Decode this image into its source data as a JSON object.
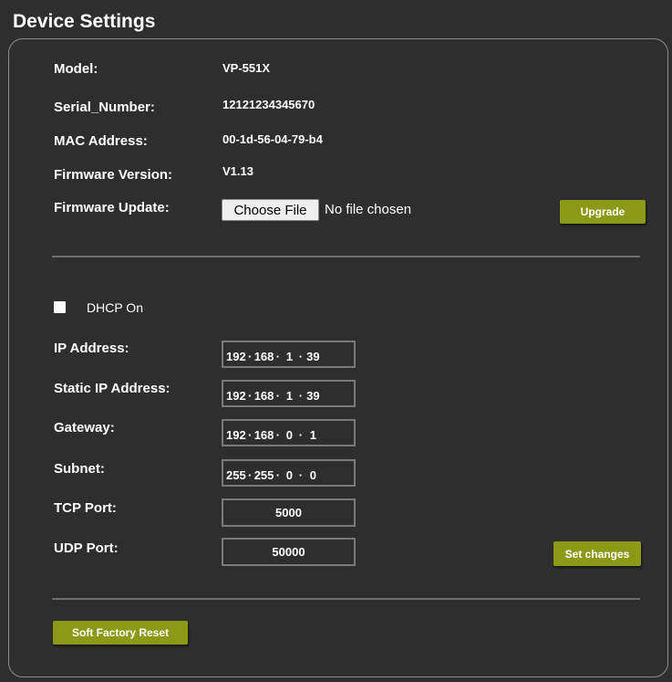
{
  "title": "Device Settings",
  "info": {
    "model_label": "Model:",
    "model_value": "VP-551X",
    "serial_label": "Serial_Number:",
    "serial_value": "12121234345670",
    "mac_label": "MAC Address:",
    "mac_value": "00-1d-56-04-79-b4",
    "fw_version_label": "Firmware Version:",
    "fw_version_value": "V1.13",
    "fw_update_label": "Firmware Update:",
    "choose_file_label": "Choose File",
    "no_file_text": "No file chosen",
    "upgrade_label": "Upgrade"
  },
  "network": {
    "dhcp_label": "DHCP On",
    "dhcp_checked": false,
    "ip_label": "IP Address:",
    "ip": [
      "192",
      "168",
      "1",
      "39"
    ],
    "static_ip_label": "Static IP Address:",
    "static_ip": [
      "192",
      "168",
      "1",
      "39"
    ],
    "gateway_label": "Gateway:",
    "gateway": [
      "192",
      "168",
      "0",
      "1"
    ],
    "subnet_label": "Subnet:",
    "subnet": [
      "255",
      "255",
      "0",
      "0"
    ],
    "tcp_label": "TCP Port:",
    "tcp_value": "5000",
    "udp_label": "UDP Port:",
    "udp_value": "50000",
    "set_changes_label": "Set changes"
  },
  "soft_reset_label": "Soft Factory Reset",
  "colors": {
    "background": "#2e2e2e",
    "accent_button": "#8a9a16",
    "border": "#8c8c8c"
  }
}
